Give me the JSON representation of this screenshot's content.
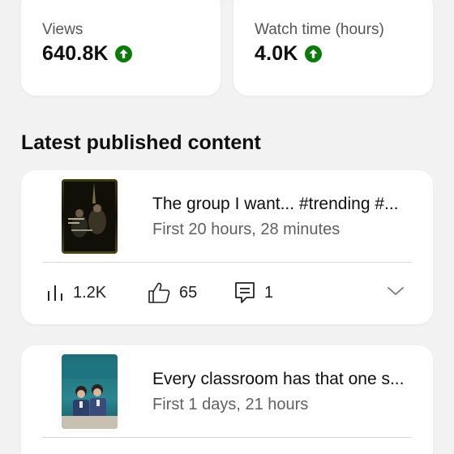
{
  "stats": {
    "views": {
      "label": "Views",
      "value": "640.8K"
    },
    "watch_time": {
      "label": "Watch time (hours)",
      "value": "4.0K"
    },
    "trend_color": "#0b7a0b"
  },
  "section": {
    "title": "Latest published content"
  },
  "content": [
    {
      "title": "The group I want... #trending #...",
      "subtitle": "First 20 hours, 28 minutes",
      "metrics": {
        "views": "1.2K",
        "likes": "65",
        "comments": "1"
      }
    },
    {
      "title": "Every classroom has that one s...",
      "subtitle": "First 1 days, 21 hours"
    }
  ],
  "icons": [
    "arrow-up-circle-icon",
    "bar-chart-icon",
    "thumbs-up-icon",
    "comment-icon",
    "chevron-down-icon"
  ]
}
